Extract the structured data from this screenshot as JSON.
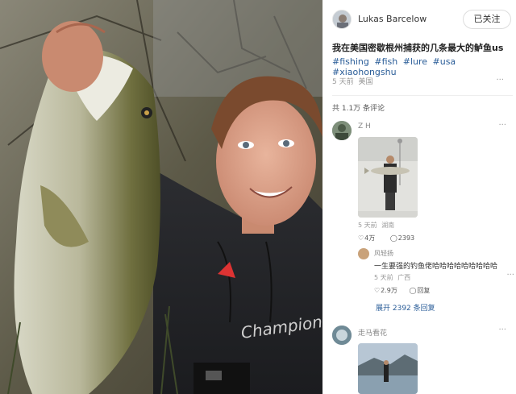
{
  "author": {
    "name": "Lukas Barcelow",
    "follow_label": "已关注"
  },
  "post": {
    "title": "我在美国密歇根州捕获的几条最大的鲈鱼us",
    "tags": [
      "#fishing",
      "#fish",
      "#lure",
      "#usa",
      "#xiaohongshu"
    ],
    "time": "5 天前",
    "location": "美国",
    "more": "···"
  },
  "comments_header": {
    "total": "共 1.1万 条评论"
  },
  "comments": [
    {
      "name": "Z H",
      "time": "5 天前",
      "location": "湖南",
      "likes": "4万",
      "replies": "2393",
      "more": "···",
      "reply": {
        "name": "风轻扬",
        "text": "一生要强的钓鱼佬哈哈哈哈哈哈哈哈哈",
        "time": "5 天前",
        "location": "广西",
        "likes": "2.9万",
        "reply_label": "回复",
        "more": "···"
      },
      "expand_label": "展开 2392 条回复"
    },
    {
      "name": "走马看花",
      "more": "···"
    }
  ],
  "icons": {
    "heart": "heart-icon",
    "comment": "comment-bubble-icon"
  }
}
